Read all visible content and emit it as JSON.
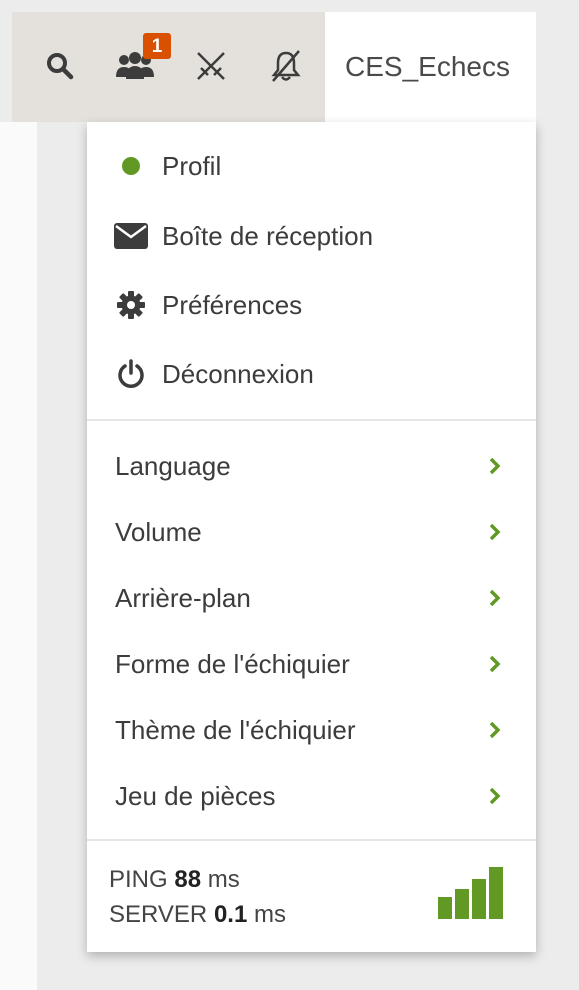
{
  "topbar": {
    "icons": [
      "search-icon",
      "friends-icon",
      "swords-muted-icon",
      "bell-muted-icon"
    ],
    "friends_badge": "1",
    "username": "CES_Echecs"
  },
  "menu": {
    "primary": [
      {
        "label": "Profil",
        "icon": "online-dot-icon"
      },
      {
        "label": "Boîte de réception",
        "icon": "envelope-icon"
      },
      {
        "label": "Préférences",
        "icon": "gear-icon"
      },
      {
        "label": "Déconnexion",
        "icon": "power-icon"
      }
    ],
    "submenus": [
      {
        "label": "Language"
      },
      {
        "label": "Volume"
      },
      {
        "label": "Arrière-plan"
      },
      {
        "label": "Forme de l'échiquier"
      },
      {
        "label": "Thème de l'échiquier"
      },
      {
        "label": "Jeu de pièces"
      }
    ]
  },
  "status": {
    "ping_label": "PING",
    "ping_value": "88",
    "ping_unit": "ms",
    "server_label": "SERVER",
    "server_value": "0.1",
    "server_unit": "ms",
    "signal_bars": 4
  },
  "colors": {
    "accent_green": "#629924",
    "badge_orange": "#d85000",
    "icon_dark": "#3c3c3c"
  }
}
